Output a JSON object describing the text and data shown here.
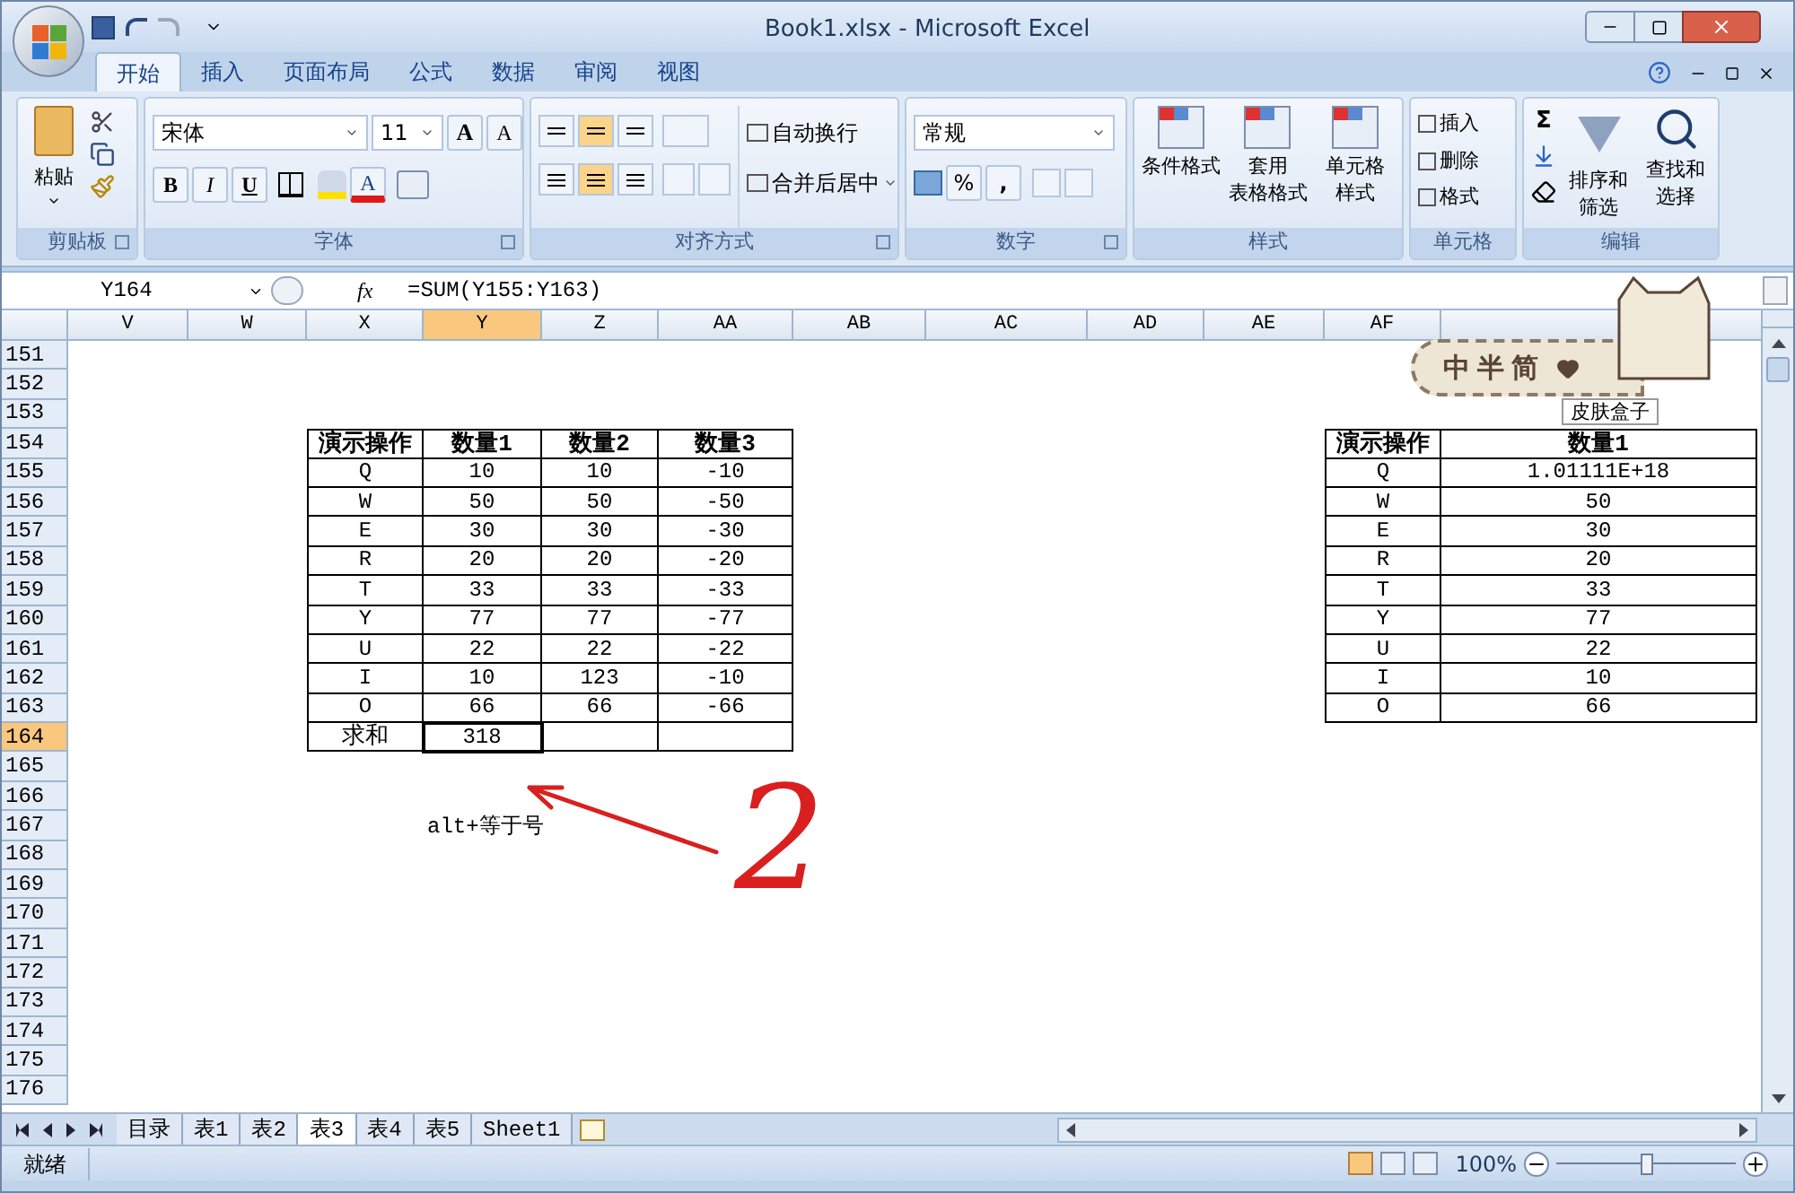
{
  "window": {
    "title": "Book1.xlsx - Microsoft Excel"
  },
  "tabs": [
    {
      "label": "开始",
      "selected": true
    },
    {
      "label": "插入",
      "selected": false
    },
    {
      "label": "页面布局",
      "selected": false
    },
    {
      "label": "公式",
      "selected": false
    },
    {
      "label": "数据",
      "selected": false
    },
    {
      "label": "审阅",
      "selected": false
    },
    {
      "label": "视图",
      "selected": false
    }
  ],
  "ribbon": {
    "clipboard": {
      "paste": "粘贴",
      "label": "剪贴板"
    },
    "font": {
      "name": "宋体",
      "size": "11",
      "grow": "A",
      "shrink": "A",
      "bold": "B",
      "italic": "I",
      "underline": "U",
      "font_color_label": "A",
      "label": "字体"
    },
    "alignment": {
      "wrap": "自动换行",
      "merge": "合并后居中",
      "label": "对齐方式"
    },
    "number": {
      "format": "常规",
      "percent": "%",
      "comma": ",",
      "label": "数字"
    },
    "styles": {
      "buttons": [
        [
          "条件格式"
        ],
        [
          "套用",
          "表格格式"
        ],
        [
          "单元格",
          "样式"
        ]
      ],
      "label": "样式"
    },
    "cells": {
      "items": [
        "插入",
        "删除",
        "格式"
      ],
      "label": "单元格"
    },
    "editing": {
      "sum": "Σ",
      "buttons": [
        [
          "排序和",
          "筛选"
        ],
        [
          "查找和",
          "选择"
        ]
      ],
      "label": "编辑"
    }
  },
  "formula_bar": {
    "name_box": "Y164",
    "fx": "fx",
    "formula": "=SUM(Y155:Y163)"
  },
  "sheet": {
    "columns": [
      {
        "label": "V",
        "selected": false
      },
      {
        "label": "W",
        "selected": false
      },
      {
        "label": "X",
        "selected": false
      },
      {
        "label": "Y",
        "selected": true
      },
      {
        "label": "Z",
        "selected": false
      },
      {
        "label": "AA",
        "selected": false
      },
      {
        "label": "AB",
        "selected": false
      },
      {
        "label": "AC",
        "selected": false
      },
      {
        "label": "AD",
        "selected": false
      },
      {
        "label": "AE",
        "selected": false
      },
      {
        "label": "AF",
        "selected": false
      }
    ],
    "rows": [
      {
        "label": "151",
        "selected": false
      },
      {
        "label": "152",
        "selected": false
      },
      {
        "label": "153",
        "selected": false
      },
      {
        "label": "154",
        "selected": false
      },
      {
        "label": "155",
        "selected": false
      },
      {
        "label": "156",
        "selected": false
      },
      {
        "label": "157",
        "selected": false
      },
      {
        "label": "158",
        "selected": false
      },
      {
        "label": "159",
        "selected": false
      },
      {
        "label": "160",
        "selected": false
      },
      {
        "label": "161",
        "selected": false
      },
      {
        "label": "162",
        "selected": false
      },
      {
        "label": "163",
        "selected": false
      },
      {
        "label": "164",
        "selected": true
      },
      {
        "label": "165",
        "selected": false
      },
      {
        "label": "166",
        "selected": false
      },
      {
        "label": "167",
        "selected": false
      },
      {
        "label": "168",
        "selected": false
      },
      {
        "label": "169",
        "selected": false
      },
      {
        "label": "170",
        "selected": false
      },
      {
        "label": "171",
        "selected": false
      },
      {
        "label": "172",
        "selected": false
      },
      {
        "label": "173",
        "selected": false
      },
      {
        "label": "174",
        "selected": false
      },
      {
        "label": "175",
        "selected": false
      },
      {
        "label": "176",
        "selected": false
      }
    ],
    "tables": [
      {
        "header": [
          "演示操作",
          "数量1",
          "数量2",
          "数量3"
        ],
        "rows": [
          [
            "Q",
            "10",
            "10",
            "-10"
          ],
          [
            "W",
            "50",
            "50",
            "-50"
          ],
          [
            "E",
            "30",
            "30",
            "-30"
          ],
          [
            "R",
            "20",
            "20",
            "-20"
          ],
          [
            "T",
            "33",
            "33",
            "-33"
          ],
          [
            "Y",
            "77",
            "77",
            "-77"
          ],
          [
            "U",
            "22",
            "22",
            "-22"
          ],
          [
            "I",
            "10",
            "123",
            "-10"
          ],
          [
            "O",
            "66",
            "66",
            "-66"
          ]
        ],
        "total": {
          "label": "求和",
          "value": "318",
          "selected": true
        }
      },
      {
        "header": [
          "演示操作",
          "数量1"
        ],
        "rows": [
          [
            "Q",
            "1.01111E+18"
          ],
          [
            "W",
            "50"
          ],
          [
            "E",
            "30"
          ],
          [
            "R",
            "20"
          ],
          [
            "T",
            "33"
          ],
          [
            "Y",
            "77"
          ],
          [
            "U",
            "22"
          ],
          [
            "I",
            "10"
          ],
          [
            "O",
            "66"
          ]
        ]
      }
    ],
    "note": "alt+等于号"
  },
  "annotation": {
    "label": "2"
  },
  "sticker": {
    "title": "中半简",
    "tag": "皮肤盒子"
  },
  "sheet_tabs": [
    {
      "label": "目录",
      "selected": false
    },
    {
      "label": "表1",
      "selected": false
    },
    {
      "label": "表2",
      "selected": false
    },
    {
      "label": "表3",
      "selected": true
    },
    {
      "label": "表4",
      "selected": false
    },
    {
      "label": "表5",
      "selected": false
    },
    {
      "label": "Sheet1",
      "selected": false
    }
  ],
  "status_bar": {
    "status": "就绪",
    "zoom": "100%",
    "zoom_slider": {
      "level": 0.5
    }
  }
}
